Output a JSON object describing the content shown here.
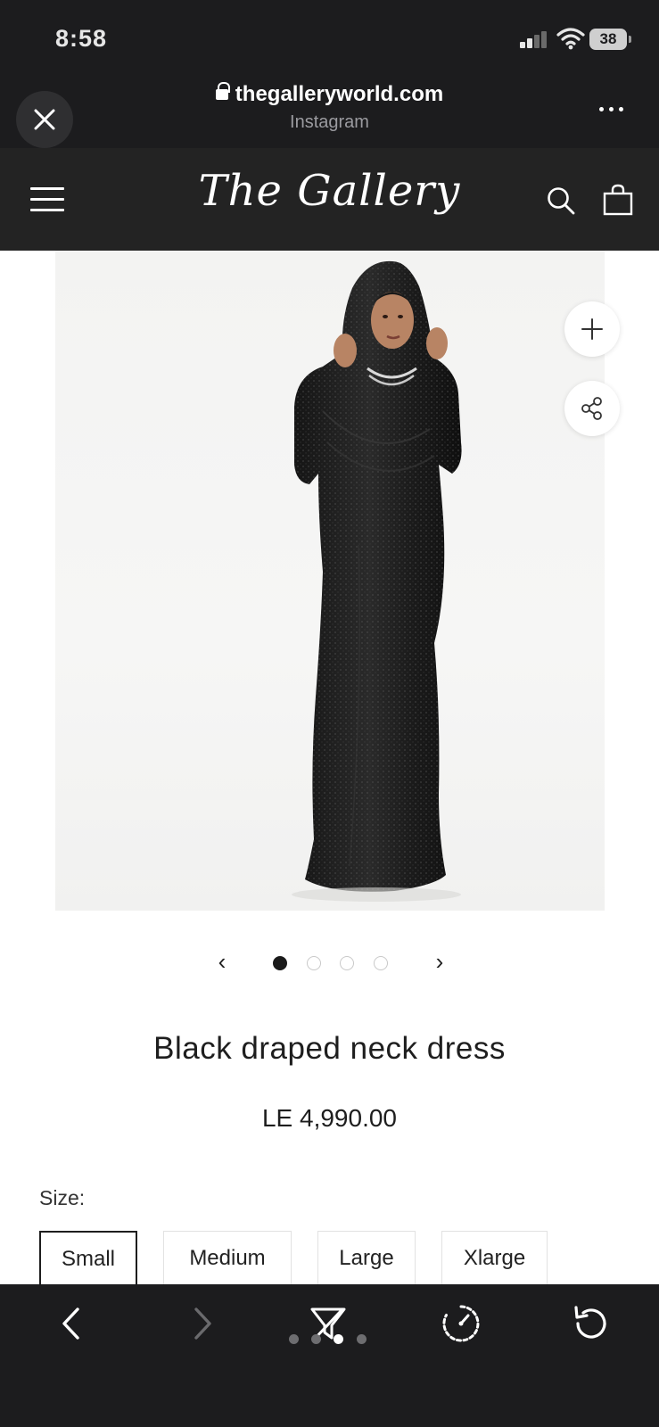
{
  "status_bar": {
    "time": "8:58",
    "battery_level": "38",
    "signal_bars_active": 2
  },
  "browser": {
    "domain": "thegalleryworld.com",
    "source": "Instagram",
    "icons": [
      "close-icon",
      "lock-icon",
      "more-icon"
    ]
  },
  "site_header": {
    "logo": "The Gallery",
    "icons": [
      "hamburger-menu-icon",
      "search-icon",
      "shopping-bag-icon"
    ]
  },
  "product": {
    "image_alt": "model-in-black-sequin-hooded-dress",
    "title": "Black draped neck dress",
    "price": "LE 4,990.00",
    "size_label": "Size:",
    "sizes": [
      "Small",
      "Medium",
      "Large",
      "Xlarge"
    ],
    "selected_size": "Small"
  },
  "carousel": {
    "total_images": 4,
    "active_index": 0,
    "prev_glyph": "‹",
    "next_glyph": "›"
  },
  "toolbar": {
    "icons": [
      "back-icon",
      "forward-icon",
      "filter-icon",
      "timer-icon",
      "refresh-icon"
    ],
    "page_count": 4,
    "active_page": 2
  },
  "colors": {
    "chrome_dark": "#1c1c1e",
    "site_header": "#232323",
    "text_dark": "#1e1e1e",
    "active_dot": "#1a1a1a"
  }
}
